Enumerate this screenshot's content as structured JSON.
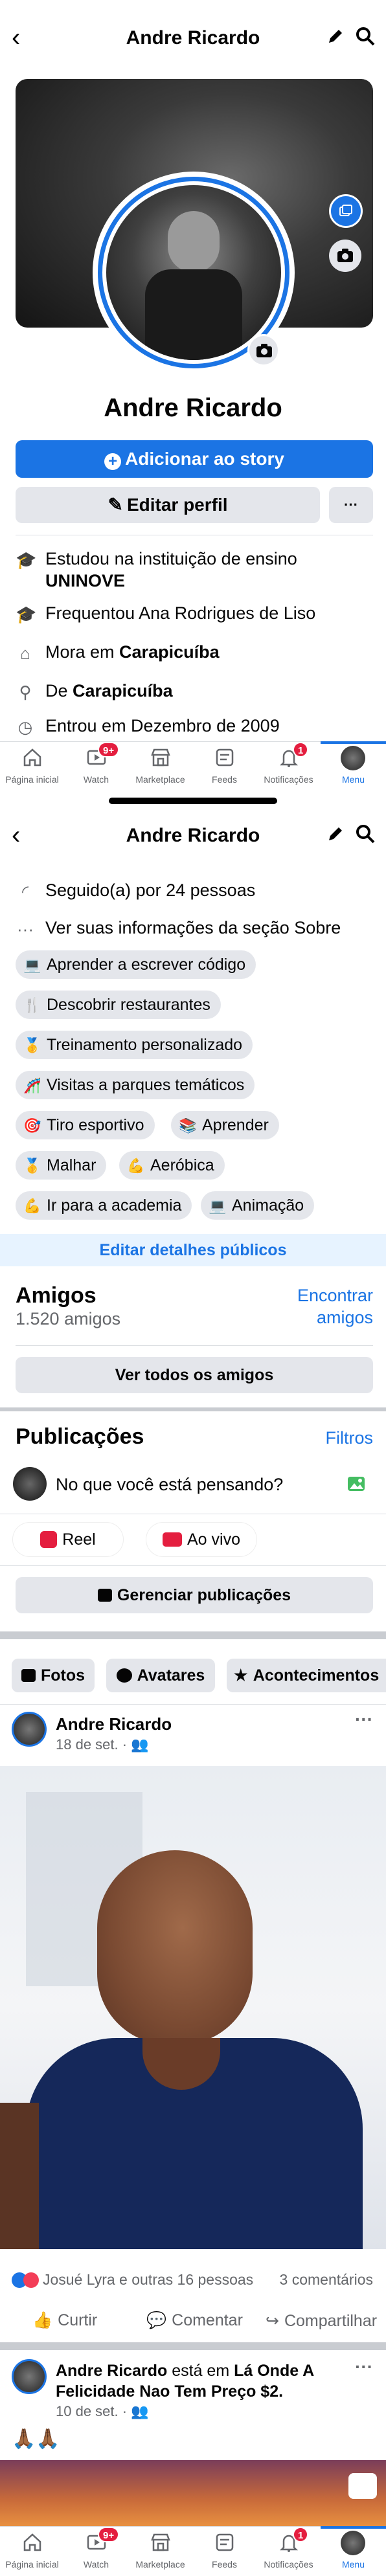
{
  "header": {
    "title": "Andre Ricardo"
  },
  "profile": {
    "name": "Andre Ricardo",
    "add_story_label": "Adicionar ao story",
    "edit_profile_label": "Editar perfil",
    "more_label": "···"
  },
  "info": {
    "studied_prefix": "Estudou na instituição de ensino",
    "studied_place": "UNINOVE",
    "attended_prefix": "Frequentou Ana Rodrigues de Liso",
    "lives_prefix": "Mora em",
    "lives_place": "Carapicuíba",
    "from_prefix": "De",
    "from_place": "Carapicuíba",
    "joined": "Entrou em Dezembro de 2009",
    "followed": "Seguido(a) por 24 pessoas",
    "about": "Ver suas informações da seção Sobre"
  },
  "interests": [
    {
      "emoji": "💻",
      "label": "Aprender a escrever código"
    },
    {
      "emoji": "🍴",
      "label": "Descobrir restaurantes"
    },
    {
      "emoji": "🥇",
      "label": "Treinamento personalizado"
    },
    {
      "emoji": "🎢",
      "label": "Visitas a parques temáticos"
    },
    {
      "emoji": "🎯",
      "label": "Tiro esportivo"
    },
    {
      "emoji": "📚",
      "label": "Aprender"
    },
    {
      "emoji": "🥇",
      "label": "Malhar"
    },
    {
      "emoji": "💪",
      "label": "Aeróbica"
    },
    {
      "emoji": "💪",
      "label": "Ir para a academia"
    },
    {
      "emoji": "💻",
      "label": "Animação"
    }
  ],
  "edit_public_label": "Editar detalhes públicos",
  "friends": {
    "title": "Amigos",
    "count": "1.520 amigos",
    "find_label_1": "Encontrar",
    "find_label_2": "amigos",
    "see_all_label": "Ver todos os amigos"
  },
  "publications": {
    "title": "Publicações",
    "filters_label": "Filtros",
    "composer_placeholder": "No que você está pensando?",
    "reel_label": "Reel",
    "live_label": "Ao vivo",
    "manage_label": "Gerenciar publicações"
  },
  "content_tabs": [
    {
      "icon": "photos-icon",
      "label": "Fotos"
    },
    {
      "icon": "avatars-icon",
      "label": "Avatares"
    },
    {
      "icon": "events-icon",
      "label": "Acontecimentos"
    }
  ],
  "post1": {
    "author": "Andre Ricardo",
    "date": "18 de set. ·",
    "reactions": "Josué Lyra e outras 16 pessoas",
    "comments": "3 comentários",
    "like_label": "Curtir",
    "comment_label": "Comentar",
    "share_label": "Compartilhar"
  },
  "post2": {
    "author": "Andre Ricardo",
    "verb": "está em",
    "place": "Lá Onde A Felicidade Nao Tem Preço $2.",
    "date": "10 de set. ·",
    "emoji": "🙏🏾🙏🏾"
  },
  "tabbar": {
    "items": [
      {
        "label": "Página inicial",
        "icon": "home-icon"
      },
      {
        "label": "Watch",
        "icon": "watch-icon",
        "badge": "9+"
      },
      {
        "label": "Marketplace",
        "icon": "marketplace-icon"
      },
      {
        "label": "Feeds",
        "icon": "feeds-icon"
      },
      {
        "label": "Notificações",
        "icon": "bell-icon",
        "badge": "1"
      },
      {
        "label": "Menu",
        "icon": "menu-avatar-icon"
      }
    ]
  },
  "colors": {
    "accent": "#1b74e4",
    "badge": "#e41e3f",
    "secondary_text": "#65676b",
    "button_gray": "#e4e6eb"
  }
}
